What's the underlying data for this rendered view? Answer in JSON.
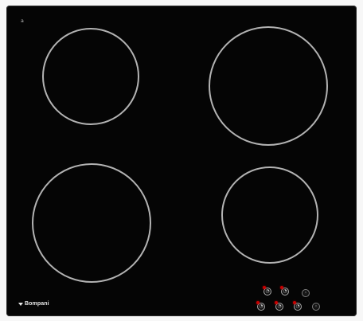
{
  "product": {
    "brand": "Bompani",
    "badge": "a"
  },
  "cooktop": {
    "zones": [
      {
        "id": "top-left",
        "label": ""
      },
      {
        "id": "top-right",
        "label": ""
      },
      {
        "id": "bottom-left",
        "label": ""
      },
      {
        "id": "bottom-right",
        "label": ""
      }
    ]
  },
  "controls": {
    "buttons": [
      {
        "id": "control-1",
        "label": ""
      },
      {
        "id": "control-2",
        "label": ""
      },
      {
        "id": "control-3",
        "label": ""
      },
      {
        "id": "control-4",
        "label": ""
      },
      {
        "id": "control-5",
        "label": ""
      },
      {
        "id": "control-6",
        "label": ""
      },
      {
        "id": "control-7",
        "label": ""
      }
    ],
    "indicator_color": "#c70000"
  },
  "colors": {
    "glass": "#050505",
    "zone_outline": "#bdbdbd",
    "brand_text": "#e7e7e7"
  }
}
